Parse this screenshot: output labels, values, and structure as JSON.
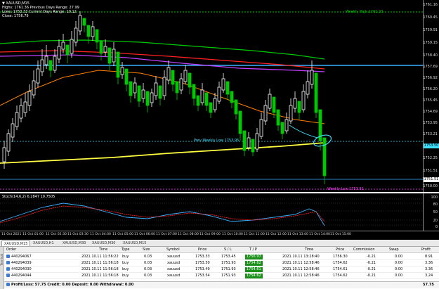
{
  "chart": {
    "symbol_line": "▼ XAUUSD,M15",
    "info_lines": [
      "Highs: 1761.36    Previous Days Range: 27.99",
      "Lows: 1753.33    Current Days Range: 10.12",
      "Close: 1756.79"
    ],
    "y_ticks": [
      "1761.16",
      "1760.45",
      "1759.91",
      "1759.15",
      "1758.40",
      "1757.69",
      "1756.92",
      "1756.20",
      "1755.45",
      "1754.69",
      "1753.95",
      "1753.21",
      "1752.25",
      "1751.51",
      "1750.00"
    ],
    "labels": {
      "weekly_high": "Weekly High 1761.33",
      "prev_weekly_low": "Prev Weekly Low 1753.95",
      "weekly_low": "Weekly Low 1753.91"
    },
    "price_boxes": [
      "1753.50",
      "1751.51"
    ],
    "colors": {
      "bull": "#ffffff",
      "bear": "#00c800",
      "ma_green": "#00c800",
      "ma_red": "#ff2020",
      "ma_violet": "#c040ff",
      "ma_orange": "#ff8000",
      "ma_yellow": "#ffff40",
      "hline_blue": "#3cb0ff",
      "dotted_green": "#00c800",
      "cyan": "#40e0ff"
    }
  },
  "oscillator": {
    "title": "Stoch(14,6,2) 6.2847 19.7505",
    "y_ticks": [
      "100",
      "80",
      "50",
      "20",
      "0"
    ]
  },
  "time_axis": {
    "ticks": [
      "11 Oct 2021",
      "11 Oct 01:00",
      "11 Oct 02:30",
      "11 Oct 03:30",
      "11 Oct 04:00",
      "11 Oct 05:00",
      "11 Oct 06:00",
      "11 Oct 07:00",
      "11 Oct 08:00",
      "11 Oct 09:00",
      "11 Oct 10:00",
      "11 Oct 11:00",
      "11 Oct 12:00",
      "11 Oct 13:00",
      "11 Oct 14:00",
      "11 Oct 15:00"
    ]
  },
  "tabs": [
    "XAUUSD,M15",
    "XAUUSD,H1",
    "XAUUSD,M30",
    "XAUUSD,M30",
    "XAUUSD,M15"
  ],
  "terminal": {
    "side_label": "Terminal",
    "headers": [
      "Order",
      "Time",
      "Type",
      "Size",
      "Symbol",
      "Price",
      "S / L",
      "T / P",
      "Time",
      "Price",
      "Commission",
      "Swap",
      "Profit"
    ],
    "rows": [
      {
        "order": "440294067",
        "time": "2021.10.11 11:56:22",
        "type": "buy",
        "size": "0.03",
        "symbol": "xauusd",
        "price": "1753.33",
        "sl": "1753.45",
        "tp": "1756.97",
        "ctime": "2021.10.11 13:28:40",
        "cprice": "1756.30",
        "commission": "-0.21",
        "swap": "0.00",
        "profit": "8.91"
      },
      {
        "order": "440294039",
        "time": "2021.10.11 11:56:18",
        "type": "buy",
        "size": "0.03",
        "symbol": "xauusd",
        "price": "1753.50",
        "sl": "1751.93",
        "tp": "1754.62",
        "ctime": "2021.10.11 12:58:46",
        "cprice": "1754.62",
        "commission": "-0.21",
        "swap": "0.00",
        "profit": "3.36"
      },
      {
        "order": "440294030",
        "time": "2021.10.11 11:56:18",
        "type": "buy",
        "size": "0.03",
        "symbol": "xauusd",
        "price": "1753.49",
        "sl": "1751.93",
        "tp": "1754.61",
        "ctime": "2021.10.11 12:58:46",
        "cprice": "1754.61",
        "commission": "-0.21",
        "swap": "0.00",
        "profit": "3.36"
      },
      {
        "order": "440294044",
        "time": "2021.10.11 11:56:18",
        "type": "buy",
        "size": "0.03",
        "symbol": "xauusd",
        "price": "1753.54",
        "sl": "1751.93",
        "tp": "1754.62",
        "ctime": "2021.10.11 12:58:46",
        "cprice": "1754.62",
        "commission": "-0.21",
        "swap": "0.00",
        "profit": "3.24"
      }
    ],
    "footer": {
      "summary": "Profit/Loss: 57.75  Credit: 0.00  Deposit: 0.00  Withdrawal: 0.00",
      "total": "57.75"
    }
  }
}
